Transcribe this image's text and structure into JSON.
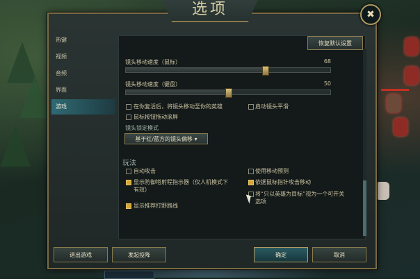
{
  "window": {
    "title": "选项",
    "close_icon": "✖"
  },
  "sidebar": {
    "items": [
      {
        "label": "热键",
        "active": false
      },
      {
        "label": "视频",
        "active": false
      },
      {
        "label": "音频",
        "active": false
      },
      {
        "label": "界面",
        "active": false
      },
      {
        "label": "游戏",
        "active": true
      }
    ]
  },
  "toolbar": {
    "reset_label": "恢复默认设置"
  },
  "camera": {
    "mouse_speed": {
      "label": "镜头移动速度（鼠标）",
      "value": "68"
    },
    "keyboard_speed": {
      "label": "镜头移动速度（键盘）",
      "value": "50"
    },
    "options": [
      {
        "label": "在你复活后，将镜头移动至你的英雄",
        "checked": false
      },
      {
        "label": "启动镜头平滑",
        "checked": false
      },
      {
        "label": "鼠标按钮拖动滚屏",
        "checked": false
      }
    ],
    "lock_mode_title": "镜头锁定模式",
    "lock_mode_value": "基于红/蓝方的镜头偏移 ▾"
  },
  "gameplay": {
    "title": "玩法",
    "options_left": [
      {
        "label": "自动攻击",
        "checked": false
      },
      {
        "label": "显示防御塔射程指示器（仅人机模式下",
        "label2": "有效）",
        "checked": true
      },
      {
        "label": "显示推荐打野路线",
        "checked": true
      }
    ],
    "options_right": [
      {
        "label": "使用移动预测",
        "checked": false
      },
      {
        "label": "依据鼠标指针攻击移动",
        "checked": true
      },
      {
        "label": "将“只以英雄为目标”视为一个可开关",
        "label2": "选项",
        "checked": false
      }
    ]
  },
  "footer": {
    "exit_label": "退出游戏",
    "surrender_label": "发起投降",
    "ok_label": "确定",
    "cancel_label": "取消"
  },
  "colors": {
    "accent": "#d6a735",
    "frame": "#8c7c4e",
    "active_tab": "#2f6a74"
  }
}
